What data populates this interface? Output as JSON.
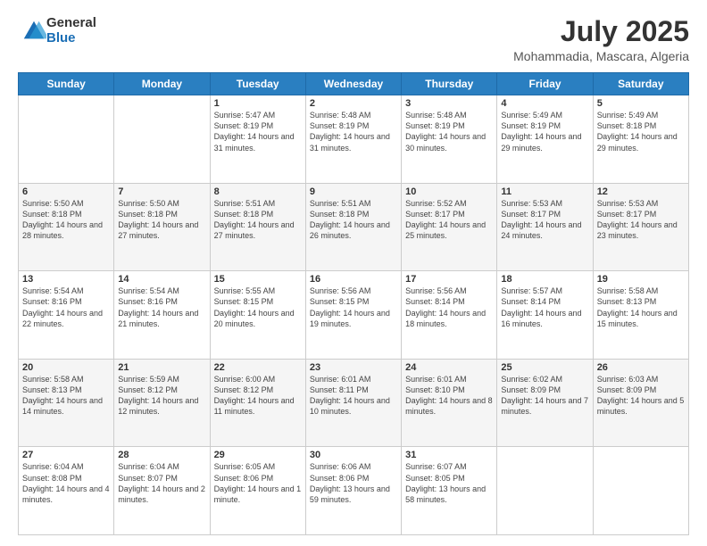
{
  "logo": {
    "general": "General",
    "blue": "Blue"
  },
  "title": "July 2025",
  "subtitle": "Mohammadia, Mascara, Algeria",
  "headers": [
    "Sunday",
    "Monday",
    "Tuesday",
    "Wednesday",
    "Thursday",
    "Friday",
    "Saturday"
  ],
  "weeks": [
    [
      {
        "day": "",
        "info": ""
      },
      {
        "day": "",
        "info": ""
      },
      {
        "day": "1",
        "info": "Sunrise: 5:47 AM\nSunset: 8:19 PM\nDaylight: 14 hours\nand 31 minutes."
      },
      {
        "day": "2",
        "info": "Sunrise: 5:48 AM\nSunset: 8:19 PM\nDaylight: 14 hours\nand 31 minutes."
      },
      {
        "day": "3",
        "info": "Sunrise: 5:48 AM\nSunset: 8:19 PM\nDaylight: 14 hours\nand 30 minutes."
      },
      {
        "day": "4",
        "info": "Sunrise: 5:49 AM\nSunset: 8:19 PM\nDaylight: 14 hours\nand 29 minutes."
      },
      {
        "day": "5",
        "info": "Sunrise: 5:49 AM\nSunset: 8:18 PM\nDaylight: 14 hours\nand 29 minutes."
      }
    ],
    [
      {
        "day": "6",
        "info": "Sunrise: 5:50 AM\nSunset: 8:18 PM\nDaylight: 14 hours\nand 28 minutes."
      },
      {
        "day": "7",
        "info": "Sunrise: 5:50 AM\nSunset: 8:18 PM\nDaylight: 14 hours\nand 27 minutes."
      },
      {
        "day": "8",
        "info": "Sunrise: 5:51 AM\nSunset: 8:18 PM\nDaylight: 14 hours\nand 27 minutes."
      },
      {
        "day": "9",
        "info": "Sunrise: 5:51 AM\nSunset: 8:18 PM\nDaylight: 14 hours\nand 26 minutes."
      },
      {
        "day": "10",
        "info": "Sunrise: 5:52 AM\nSunset: 8:17 PM\nDaylight: 14 hours\nand 25 minutes."
      },
      {
        "day": "11",
        "info": "Sunrise: 5:53 AM\nSunset: 8:17 PM\nDaylight: 14 hours\nand 24 minutes."
      },
      {
        "day": "12",
        "info": "Sunrise: 5:53 AM\nSunset: 8:17 PM\nDaylight: 14 hours\nand 23 minutes."
      }
    ],
    [
      {
        "day": "13",
        "info": "Sunrise: 5:54 AM\nSunset: 8:16 PM\nDaylight: 14 hours\nand 22 minutes."
      },
      {
        "day": "14",
        "info": "Sunrise: 5:54 AM\nSunset: 8:16 PM\nDaylight: 14 hours\nand 21 minutes."
      },
      {
        "day": "15",
        "info": "Sunrise: 5:55 AM\nSunset: 8:15 PM\nDaylight: 14 hours\nand 20 minutes."
      },
      {
        "day": "16",
        "info": "Sunrise: 5:56 AM\nSunset: 8:15 PM\nDaylight: 14 hours\nand 19 minutes."
      },
      {
        "day": "17",
        "info": "Sunrise: 5:56 AM\nSunset: 8:14 PM\nDaylight: 14 hours\nand 18 minutes."
      },
      {
        "day": "18",
        "info": "Sunrise: 5:57 AM\nSunset: 8:14 PM\nDaylight: 14 hours\nand 16 minutes."
      },
      {
        "day": "19",
        "info": "Sunrise: 5:58 AM\nSunset: 8:13 PM\nDaylight: 14 hours\nand 15 minutes."
      }
    ],
    [
      {
        "day": "20",
        "info": "Sunrise: 5:58 AM\nSunset: 8:13 PM\nDaylight: 14 hours\nand 14 minutes."
      },
      {
        "day": "21",
        "info": "Sunrise: 5:59 AM\nSunset: 8:12 PM\nDaylight: 14 hours\nand 12 minutes."
      },
      {
        "day": "22",
        "info": "Sunrise: 6:00 AM\nSunset: 8:12 PM\nDaylight: 14 hours\nand 11 minutes."
      },
      {
        "day": "23",
        "info": "Sunrise: 6:01 AM\nSunset: 8:11 PM\nDaylight: 14 hours\nand 10 minutes."
      },
      {
        "day": "24",
        "info": "Sunrise: 6:01 AM\nSunset: 8:10 PM\nDaylight: 14 hours\nand 8 minutes."
      },
      {
        "day": "25",
        "info": "Sunrise: 6:02 AM\nSunset: 8:09 PM\nDaylight: 14 hours\nand 7 minutes."
      },
      {
        "day": "26",
        "info": "Sunrise: 6:03 AM\nSunset: 8:09 PM\nDaylight: 14 hours\nand 5 minutes."
      }
    ],
    [
      {
        "day": "27",
        "info": "Sunrise: 6:04 AM\nSunset: 8:08 PM\nDaylight: 14 hours\nand 4 minutes."
      },
      {
        "day": "28",
        "info": "Sunrise: 6:04 AM\nSunset: 8:07 PM\nDaylight: 14 hours\nand 2 minutes."
      },
      {
        "day": "29",
        "info": "Sunrise: 6:05 AM\nSunset: 8:06 PM\nDaylight: 14 hours\nand 1 minute."
      },
      {
        "day": "30",
        "info": "Sunrise: 6:06 AM\nSunset: 8:06 PM\nDaylight: 13 hours\nand 59 minutes."
      },
      {
        "day": "31",
        "info": "Sunrise: 6:07 AM\nSunset: 8:05 PM\nDaylight: 13 hours\nand 58 minutes."
      },
      {
        "day": "",
        "info": ""
      },
      {
        "day": "",
        "info": ""
      }
    ]
  ]
}
